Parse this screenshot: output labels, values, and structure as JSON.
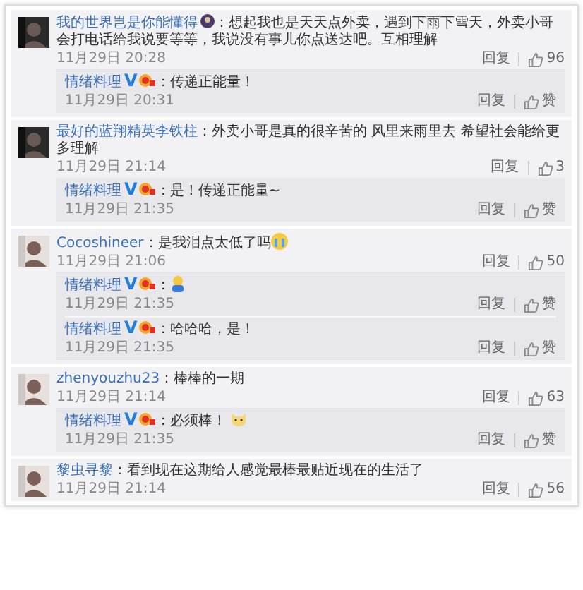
{
  "comments": [
    {
      "user": "我的世界岂是你能懂得",
      "user_icon": true,
      "text": "：想起我也是天天点外卖，遇到下雨下雪天，外卖小哥会打电话给我说要等等，我说没有事儿你点送达吧。互相理解",
      "time": "11月29日 20:28",
      "reply_label": "回复",
      "likes": "96",
      "replies": [
        {
          "user": "情绪料理",
          "badge": "V",
          "text": "：传递正能量！",
          "time": "11月29日 20:31",
          "reply_label": "回复",
          "likes": "赞"
        }
      ]
    },
    {
      "user": "最好的蓝翔精英李铁柱",
      "user_icon": false,
      "text": "：外卖小哥是真的很辛苦的 风里来雨里去 希望社会能给更多理解",
      "time": "11月29日 21:14",
      "reply_label": "回复",
      "likes": "3",
      "replies": [
        {
          "user": "情绪料理",
          "badge": "V",
          "text": "：是！传递正能量~",
          "time": "11月29日 21:35",
          "reply_label": "回复",
          "likes": "赞"
        }
      ]
    },
    {
      "user": "Cocoshineer",
      "user_icon": false,
      "text": "：是我泪点太低了吗",
      "emojis": [
        {
          "kind": "crying"
        }
      ],
      "time": "11月29日 21:06",
      "reply_label": "回复",
      "likes": "50",
      "replies": [
        {
          "user": "情绪料理",
          "badge": "V",
          "text": "：",
          "emojis": [
            {
              "kind": "figure"
            }
          ],
          "time": "11月29日 21:35",
          "reply_label": "回复",
          "likes": "赞"
        },
        {
          "user": "情绪料理",
          "badge": "V",
          "text": "：哈哈哈，是！",
          "time": "11月29日 21:35",
          "reply_label": "回复",
          "likes": "赞"
        }
      ]
    },
    {
      "user": "zhenyouzhu23",
      "user_icon": false,
      "text": "：棒棒的一期",
      "time": "11月29日 21:14",
      "reply_label": "回复",
      "likes": "63",
      "replies": [
        {
          "user": "情绪料理",
          "badge": "V",
          "text": "：必须棒！",
          "emojis": [
            {
              "kind": "cat"
            }
          ],
          "time": "11月29日 21:35",
          "reply_label": "回复",
          "likes": "赞"
        }
      ]
    },
    {
      "user": "黎虫寻黎",
      "user_icon": false,
      "text": "：看到现在这期给人感觉最棒最贴近现在的生活了",
      "time": "11月29日 21:14",
      "reply_label": "回复",
      "likes": "56"
    }
  ]
}
